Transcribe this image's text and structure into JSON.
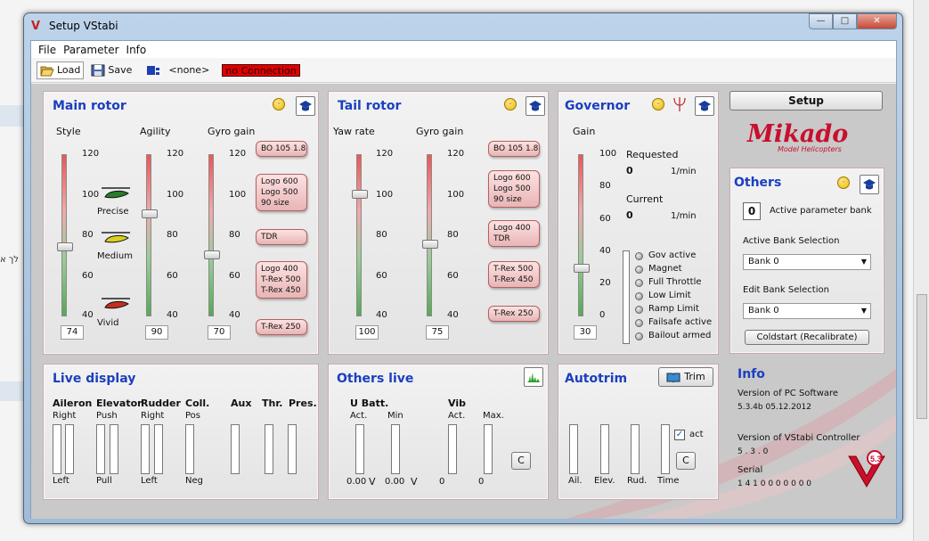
{
  "window": {
    "title": "Setup VStabi",
    "controls": {
      "minimize": "—",
      "maximize": "□",
      "close": "✕"
    }
  },
  "background": {
    "side_text": "לך א"
  },
  "menu": [
    "File",
    "Parameter",
    "Info"
  ],
  "toolbar": {
    "load": "Load",
    "save": "Save",
    "profile": "<none>",
    "connection": "no Connection"
  },
  "main_rotor": {
    "title": "Main rotor",
    "style": {
      "label": "Style",
      "value": "74",
      "ticks": [
        "120",
        "100",
        "80",
        "60",
        "40"
      ],
      "options": [
        "Precise",
        "Medium",
        "Vivid"
      ]
    },
    "agility": {
      "label": "Agility",
      "value": "90",
      "ticks": [
        "120",
        "100",
        "80",
        "60",
        "40"
      ]
    },
    "gyro": {
      "label": "Gyro gain",
      "value": "70",
      "ticks": [
        "120",
        "100",
        "80",
        "60",
        "40"
      ]
    },
    "callouts": [
      "BO 105 1.8",
      "Logo 600\nLogo 500\n90 size",
      "TDR",
      "Logo 400\nT-Rex 500\nT-Rex 450",
      "T-Rex 250"
    ]
  },
  "tail_rotor": {
    "title": "Tail rotor",
    "yaw": {
      "label": "Yaw rate",
      "value": "100",
      "ticks": [
        "120",
        "100",
        "80",
        "60",
        "40"
      ]
    },
    "gyro": {
      "label": "Gyro gain",
      "value": "75",
      "ticks": [
        "120",
        "100",
        "80",
        "60",
        "40"
      ]
    },
    "callouts": [
      "BO 105 1.8",
      "Logo 600\nLogo 500\n90 size",
      "Logo 400\nTDR",
      "T-Rex 500\nT-Rex 450",
      "T-Rex 250"
    ]
  },
  "governor": {
    "title": "Governor",
    "gain_label": "Gain",
    "gain_value": "30",
    "ticks": [
      "100",
      "80",
      "60",
      "40",
      "20",
      "0"
    ],
    "requested_label": "Requested",
    "requested_value": "0",
    "requested_unit": "1/min",
    "current_label": "Current",
    "current_value": "0",
    "current_unit": "1/min",
    "status": [
      "Gov active",
      "Magnet",
      "Full Throttle",
      "Low Limit",
      "Ramp Limit",
      "Failsafe active",
      "Bailout armed"
    ]
  },
  "setup": {
    "button": "Setup"
  },
  "logo": {
    "main": "Mikado",
    "sub": "Model Helicopters"
  },
  "others": {
    "title": "Others",
    "bank_value": "0",
    "bank_label": "Active parameter bank",
    "active_bank_label": "Active Bank Selection",
    "active_bank_value": "Bank 0",
    "edit_bank_label": "Edit Bank Selection",
    "edit_bank_value": "Bank 0",
    "coldstart": "Coldstart (Recalibrate)"
  },
  "live_display": {
    "title": "Live display",
    "channels": [
      {
        "name": "Aileron",
        "top": "Right",
        "bottom": "Left"
      },
      {
        "name": "Elevator",
        "top": "Push",
        "bottom": "Pull"
      },
      {
        "name": "Rudder",
        "top": "Right",
        "bottom": "Left"
      },
      {
        "name": "Coll.",
        "top": "Pos",
        "bottom": "Neg"
      },
      {
        "name": "Aux",
        "top": "",
        "bottom": ""
      },
      {
        "name": "Thr.",
        "top": "",
        "bottom": ""
      },
      {
        "name": "Pres.",
        "top": "",
        "bottom": ""
      }
    ]
  },
  "others_live": {
    "title": "Others live",
    "ubatt": "U Batt.",
    "act": "Act.",
    "min": "Min",
    "vib": "Vib",
    "max": "Max.",
    "v1": "0.00",
    "v2": "0.00",
    "unit_v": "V",
    "vib1": "0",
    "vib2": "0",
    "clear": "C"
  },
  "autotrim": {
    "title": "Autotrim",
    "trim": "Trim",
    "act": "act",
    "clear": "C",
    "labels": [
      "Ail.",
      "Elev.",
      "Rud.",
      "Time"
    ]
  },
  "info": {
    "title": "Info",
    "pc_label": "Version of PC Software",
    "pc_value": "5.3.4b 05.12.2012",
    "ctrl_label": "Version of VStabi Controller",
    "ctrl_value": "5 . 3 . 0",
    "serial_label": "Serial",
    "serial_value": "1 4 1 0 0 0 0 0 0 0"
  }
}
